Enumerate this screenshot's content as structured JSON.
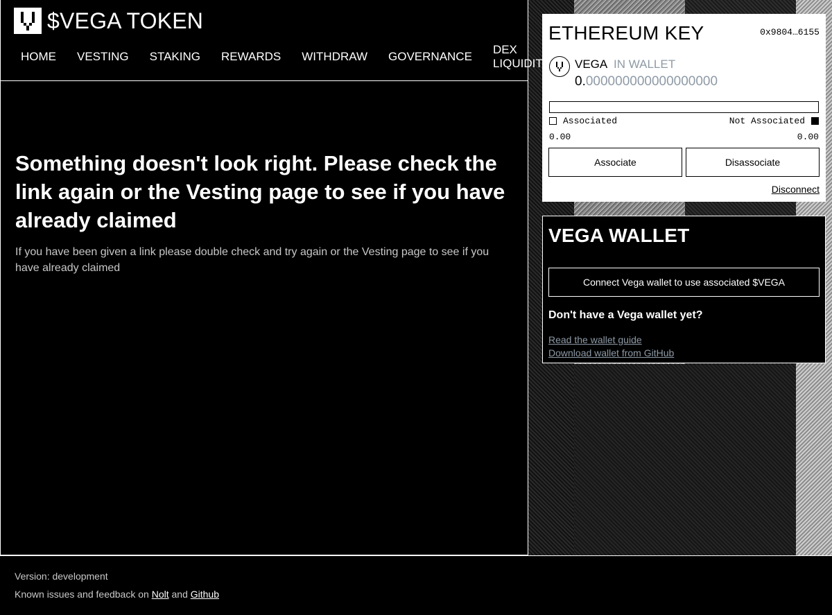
{
  "header": {
    "title": "$VEGA TOKEN",
    "nav": [
      {
        "label": "HOME"
      },
      {
        "label": "VESTING"
      },
      {
        "label": "STAKING"
      },
      {
        "label": "REWARDS"
      },
      {
        "label": "WITHDRAW"
      },
      {
        "label": "GOVERNANCE"
      },
      {
        "label": "DEX LIQUIDITY"
      }
    ]
  },
  "main": {
    "heading": "Something doesn't look right. Please check the link again or the Vesting page to see if you have already claimed",
    "message": "If you have been given a link please double check and try again or the Vesting page to see if you have already claimed"
  },
  "ethereum": {
    "title": "ETHEREUM KEY",
    "address": "0x9804…6155",
    "token_name": "VEGA",
    "token_status": "IN WALLET",
    "balance_int": "0.",
    "balance_dec": "000000000000000000",
    "associated_label": "Associated",
    "not_associated_label": "Not Associated",
    "associated_value": "0.00",
    "not_associated_value": "0.00",
    "associate_button": "Associate",
    "disassociate_button": "Disassociate",
    "disconnect_link": "Disconnect"
  },
  "vega_wallet": {
    "title": "VEGA WALLET",
    "connect_button": "Connect Vega wallet to use associated $VEGA",
    "question": "Don't have a Vega wallet yet?",
    "guide_link": "Read the wallet guide",
    "download_link": "Download wallet from GitHub"
  },
  "footer": {
    "version": "Version: development",
    "issues_prefix": "Known issues and feedback on",
    "nolt_link": "Nolt",
    "and_text": "and",
    "github_link": "Github"
  },
  "icons": {
    "logo": "vega-logo-icon",
    "token": "vega-token-icon"
  },
  "colors": {
    "background": "#000000",
    "muted": "#8e9aa6",
    "text": "#ffffff"
  }
}
